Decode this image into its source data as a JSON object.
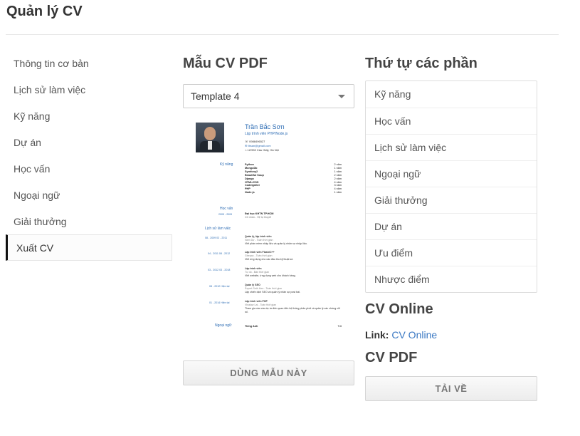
{
  "page": {
    "title": "Quản lý CV"
  },
  "sidebar": {
    "items": [
      {
        "label": "Thông tin cơ bản"
      },
      {
        "label": "Lịch sử làm việc"
      },
      {
        "label": "Kỹ năng"
      },
      {
        "label": "Dự án"
      },
      {
        "label": "Học vấn"
      },
      {
        "label": "Ngoại ngữ"
      },
      {
        "label": "Giải thưởng"
      },
      {
        "label": "Xuất CV"
      }
    ],
    "active_index": 7
  },
  "pdf_template": {
    "heading": "Mẫu CV PDF",
    "selected": "Template 4",
    "use_button": "DÙNG MẪU NÀY"
  },
  "cv_preview": {
    "name": "Trần Bắc Sơn",
    "job_title": "Lập trình viên PHP/Node.js",
    "phone": "0988496527",
    "email": "tbsan@gmail.com",
    "address": "12/953 Cầu Giấy, Hà Nội",
    "skills_heading": "Kỹ năng",
    "skills": [
      {
        "name": "Python",
        "years": "2 năm"
      },
      {
        "name": "MongoDb",
        "years": "1 năm"
      },
      {
        "name": "Symfony2",
        "years": "1 năm"
      },
      {
        "name": "Beautiful Soup",
        "years": "2 năm"
      },
      {
        "name": "Django",
        "years": "2 năm"
      },
      {
        "name": "HTML/CSS",
        "years": "4 năm"
      },
      {
        "name": "Codeigniter",
        "years": "3 năm"
      },
      {
        "name": "PHP",
        "years": "4 năm"
      },
      {
        "name": "Node.js",
        "years": "1 năm"
      }
    ],
    "education_heading": "Học vấn",
    "education": {
      "period": "2005 - 2009",
      "school": "Đại học KHTN TP.HCM",
      "detail": "Cử nhân - Hệ tự thuyết"
    },
    "work_heading": "Lịch sử làm việc",
    "work": [
      {
        "period": "08 - 2009 03 - 2011",
        "title": "Quản lý, lập trình viên",
        "company": "Nam Dự - Toàn thời gian",
        "desc": "Viết phần mềm nhập liệu và quản lý nhân sự nhập liệu."
      },
      {
        "period": "04 - 2011 08 - 2012",
        "title": "Lập trình viên Flash/C++",
        "company": "Gbepac - Toàn thời gian",
        "desc": "Viết ứng dụng cho các đầu thu kỹ thuật số."
      },
      {
        "period": "03 - 2012 03 - 2018",
        "title": "Lập trình viên",
        "company": "Tự do - Bán thời gian",
        "desc": "Viết website, ứng dụng web cho khách hàng."
      },
      {
        "period": "08 - 2012 Hiện tại",
        "title": "Quản lý SEO",
        "company": "Expert Seth Hen - Toàn thời gian",
        "desc": "Lập chiến dịch SEO và quản lý nhân sự post bài."
      },
      {
        "period": "01 - 2014 Hiện tại",
        "title": "Lập trình viên PHP",
        "company": "Vinalaw Lai - Toàn thời gian",
        "desc": "Tham gia vào các dự án liên quan đến hệ thống phân phối và quản lý các chứng chỉ số."
      }
    ],
    "language_heading": "Ngoại ngữ",
    "language": {
      "name": "Tiếng Anh",
      "level": "Tốt"
    }
  },
  "section_order": {
    "heading": "Thứ tự các phần",
    "items": [
      "Kỹ năng",
      "Học vấn",
      "Lịch sử làm việc",
      "Ngoại ngữ",
      "Giải thưởng",
      "Dự án",
      "Ưu điểm",
      "Nhược điểm"
    ]
  },
  "cv_online": {
    "heading": "CV Online",
    "link_label": "Link:",
    "link_text": "CV Online"
  },
  "cv_pdf": {
    "heading": "CV PDF",
    "download_button": "TẢI VỀ"
  },
  "colors": {
    "accent_link": "#3a78c3",
    "cv_blue": "#2e6db4"
  }
}
